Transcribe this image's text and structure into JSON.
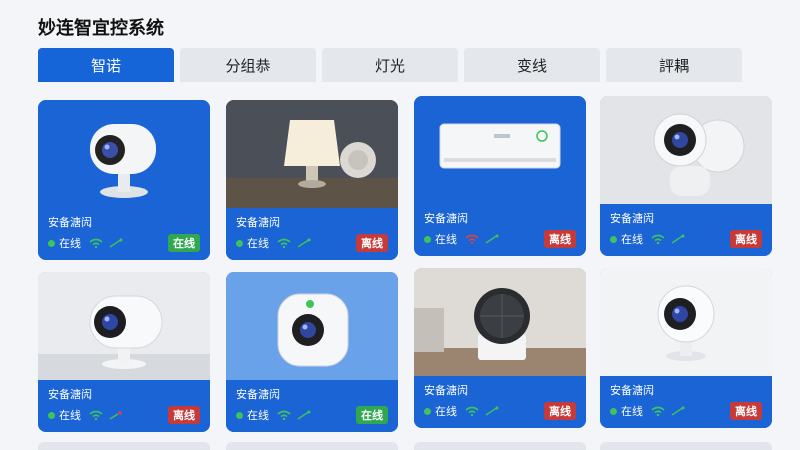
{
  "app": {
    "title": "妙连智宜控系统"
  },
  "tabs": [
    {
      "label": "智诺",
      "active": true
    },
    {
      "label": "分组恭",
      "active": false
    },
    {
      "label": "灯光",
      "active": false
    },
    {
      "label": "变线",
      "active": false
    },
    {
      "label": "評耦",
      "active": false
    }
  ],
  "devices": [
    {
      "name": "安备溏闶",
      "status": "在线",
      "badge": "在线",
      "online": true,
      "icon": "camera-icon"
    },
    {
      "name": "安备溏闶",
      "status": "在线",
      "badge": "离线",
      "online": false,
      "icon": "lamp-icon"
    },
    {
      "name": "安备溏闶",
      "status": "在线",
      "badge": "离线",
      "online": false,
      "icon": "air-conditioner-icon"
    },
    {
      "name": "安备溏闶",
      "status": "在线",
      "badge": "离线",
      "online": false,
      "icon": "camera-icon"
    },
    {
      "name": "安备溏闶",
      "status": "在线",
      "badge": "离线",
      "online": false,
      "icon": "camera-icon"
    },
    {
      "name": "安备溏闶",
      "status": "在线",
      "badge": "在线",
      "online": true,
      "icon": "camera-icon"
    },
    {
      "name": "安备溏闶",
      "status": "在线",
      "badge": "离线",
      "online": false,
      "icon": "fan-heater-icon"
    },
    {
      "name": "安备溏闶",
      "status": "在线",
      "badge": "离线",
      "online": false,
      "icon": "camera-icon"
    }
  ],
  "colors": {
    "primary": "#1565d8",
    "online": "#2fa84f",
    "offline": "#c73a3a"
  }
}
